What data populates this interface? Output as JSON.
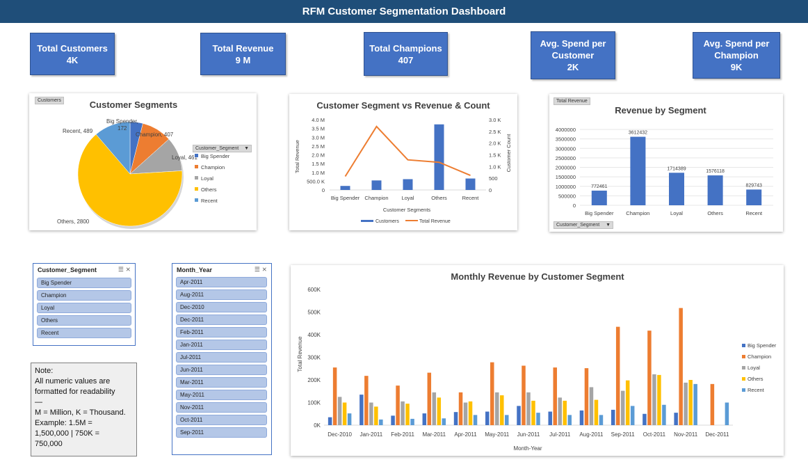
{
  "header": {
    "title": "RFM Customer Segmentation Dashboard"
  },
  "kpis": [
    {
      "label": "Total Customers",
      "value": "4K"
    },
    {
      "label": "Total Revenue",
      "value": "9 M"
    },
    {
      "label": "Total Champions",
      "value": "407"
    },
    {
      "label": "Avg. Spend per Customer",
      "value": "2K"
    },
    {
      "label": "Avg. Spend per Champion",
      "value": "9K"
    }
  ],
  "colors": {
    "big_spender": "#4472c4",
    "champion": "#ed7d31",
    "loyal": "#a5a5a5",
    "others": "#ffc000",
    "recent": "#5b9bd5",
    "header": "#1f4e79"
  },
  "pie": {
    "field_button": "Customers",
    "legend_field": "Customer_Segment",
    "title": "Customer Segments",
    "legend": [
      "Big Spender",
      "Champion",
      "Loyal",
      "Others",
      "Recent"
    ],
    "labels": {
      "big_spender_1": "Big Spender,",
      "big_spender_2": "172",
      "champion": "Champion, 407",
      "loyal": "Loyal, 461",
      "others": "Others, 2800",
      "recent": "Recent, 489"
    }
  },
  "combo": {
    "title": "Customer Segment vs Revenue & Count",
    "y_left_label": "Total Revenue",
    "y_right_label": "Customer Count",
    "x_label": "Customer Segments",
    "left_ticks": [
      "4.0 M",
      "3.5 M",
      "3.0 M",
      "2.5 M",
      "2.0 M",
      "1.5 M",
      "1.0 M",
      "500.0 K",
      "0"
    ],
    "right_ticks": [
      "3.0 K",
      "2.5 K",
      "2.0 K",
      "1.5 K",
      "1.0 K",
      "500",
      "0"
    ],
    "legend": {
      "bars": "Customers",
      "line": "Total Revenue"
    }
  },
  "rev_bar": {
    "field_button": "Total Revenue",
    "axis_field": "Customer_Segment",
    "title": "Revenue by Segment",
    "ticks": [
      "4000000",
      "3500000",
      "3000000",
      "2500000",
      "2000000",
      "1500000",
      "1000000",
      "500000",
      "0"
    ]
  },
  "slicer_segment": {
    "header": "Customer_Segment",
    "items": [
      "Big Spender",
      "Champion",
      "Loyal",
      "Others",
      "Recent"
    ]
  },
  "slicer_month": {
    "header": "Month_Year",
    "items": [
      "Apr-2011",
      "Aug-2011",
      "Dec-2010",
      "Dec-2011",
      "Feb-2011",
      "Jan-2011",
      "Jul-2011",
      "Jun-2011",
      "Mar-2011",
      "May-2011",
      "Nov-2011",
      "Oct-2011",
      "Sep-2011"
    ]
  },
  "note": {
    "l1": "Note:",
    "l2": "All numeric values are",
    "l3": "formatted for readability",
    "l4": "—",
    "l5": "M = Million, K = Thousand.",
    "l6": "Example: 1.5M =",
    "l7": "1,500,000 | 750K =",
    "l8": "750,000"
  },
  "monthly": {
    "title": "Monthly Revenue by Customer Segment",
    "y_label": "Total Revenue",
    "x_label": "Month-Year",
    "ticks": [
      "600K",
      "500K",
      "400K",
      "300K",
      "200K",
      "100K",
      "0K"
    ]
  },
  "chart_data": [
    {
      "type": "pie",
      "title": "Customer Segments",
      "categories": [
        "Big Spender",
        "Champion",
        "Loyal",
        "Others",
        "Recent"
      ],
      "values": [
        172,
        407,
        461,
        2800,
        489
      ]
    },
    {
      "type": "bar",
      "title": "Customer Segment vs Revenue & Count",
      "categories": [
        "Big Spender",
        "Champion",
        "Loyal",
        "Others",
        "Recent"
      ],
      "xlabel": "Customer Segments",
      "ylabel": "Total Revenue",
      "y2label": "Customer Count",
      "ylim": [
        0,
        4000000
      ],
      "y2lim": [
        0,
        3000
      ],
      "series": [
        {
          "name": "Customers",
          "type": "bar",
          "axis": "right",
          "values": [
            172,
            407,
            461,
            2800,
            489
          ]
        },
        {
          "name": "Total Revenue",
          "type": "line",
          "axis": "left",
          "values": [
            772461,
            3612432,
            1714389,
            1576118,
            829743
          ]
        }
      ]
    },
    {
      "type": "bar",
      "title": "Revenue by Segment",
      "categories": [
        "Big Spender",
        "Champion",
        "Loyal",
        "Others",
        "Recent"
      ],
      "values": [
        772461,
        3612432,
        1714389,
        1576118,
        829743
      ],
      "data_labels": [
        "772461",
        "3612432",
        "1714389",
        "1576118",
        "829743"
      ],
      "ylim": [
        0,
        4000000
      ]
    },
    {
      "type": "bar",
      "title": "Monthly Revenue by Customer Segment",
      "xlabel": "Month-Year",
      "ylabel": "Total Revenue",
      "ylim": [
        0,
        600000
      ],
      "categories": [
        "Dec-2010",
        "Jan-2011",
        "Feb-2011",
        "Mar-2011",
        "Apr-2011",
        "May-2011",
        "Jun-2011",
        "Jul-2011",
        "Aug-2011",
        "Sep-2011",
        "Oct-2011",
        "Nov-2011",
        "Dec-2011"
      ],
      "series": [
        {
          "name": "Big Spender",
          "values": [
            35000,
            135000,
            42000,
            52000,
            58000,
            60000,
            85000,
            60000,
            65000,
            68000,
            50000,
            55000,
            0
          ]
        },
        {
          "name": "Champion",
          "values": [
            255000,
            218000,
            175000,
            232000,
            145000,
            278000,
            263000,
            255000,
            252000,
            435000,
            418000,
            518000,
            182000
          ]
        },
        {
          "name": "Loyal",
          "values": [
            125000,
            100000,
            105000,
            145000,
            100000,
            145000,
            145000,
            122000,
            168000,
            152000,
            225000,
            188000,
            0
          ]
        },
        {
          "name": "Others",
          "values": [
            100000,
            82000,
            95000,
            122000,
            105000,
            132000,
            108000,
            108000,
            112000,
            198000,
            222000,
            200000,
            0
          ]
        },
        {
          "name": "Recent",
          "values": [
            52000,
            25000,
            28000,
            30000,
            45000,
            45000,
            55000,
            45000,
            45000,
            85000,
            90000,
            182000,
            100000
          ]
        }
      ]
    }
  ]
}
